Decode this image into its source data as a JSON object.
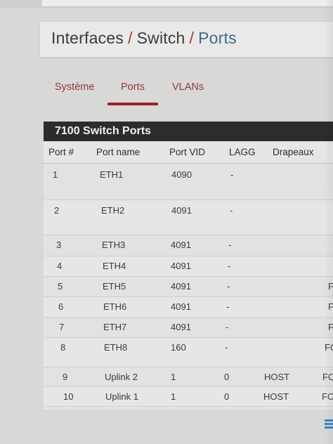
{
  "breadcrumb": {
    "items": [
      "Interfaces",
      "Switch"
    ],
    "current": "Ports",
    "separator": "/"
  },
  "tabs": [
    {
      "label": "Système",
      "active": false
    },
    {
      "label": "Ports",
      "active": true
    },
    {
      "label": "VLANs",
      "active": false
    }
  ],
  "panel": {
    "title": "7100 Switch Ports",
    "columns": [
      "Port #",
      "Port name",
      "Port VID",
      "LAGG",
      "Drapeaux"
    ],
    "rows": [
      {
        "port": "1",
        "name": "ETH1",
        "vid": "4090",
        "lagg": "-",
        "flags": "",
        "extra": ""
      },
      {
        "port": "2",
        "name": "ETH2",
        "vid": "4091",
        "lagg": "-",
        "flags": "",
        "extra": ""
      },
      {
        "port": "3",
        "name": "ETH3",
        "vid": "4091",
        "lagg": "-",
        "flags": "",
        "extra": ""
      },
      {
        "port": "4",
        "name": "ETH4",
        "vid": "4091",
        "lagg": "-",
        "flags": "",
        "extra": ""
      },
      {
        "port": "5",
        "name": "ETH5",
        "vid": "4091",
        "lagg": "-",
        "flags": "",
        "extra": "F"
      },
      {
        "port": "6",
        "name": "ETH6",
        "vid": "4091",
        "lagg": "-",
        "flags": "",
        "extra": "F"
      },
      {
        "port": "7",
        "name": "ETH7",
        "vid": "4091",
        "lagg": "-",
        "flags": "",
        "extra": "F"
      },
      {
        "port": "8",
        "name": "ETH8",
        "vid": "160",
        "lagg": "-",
        "flags": "",
        "extra": "FO"
      },
      {
        "port": "9",
        "name": "Uplink 2",
        "vid": "1",
        "lagg": "0",
        "flags": "HOST",
        "extra": "FO"
      },
      {
        "port": "10",
        "name": "Uplink 1",
        "vid": "1",
        "lagg": "0",
        "flags": "HOST",
        "extra": "FO"
      }
    ]
  },
  "colors": {
    "accent": "#a11f24",
    "heading_bg": "#2c2c2c",
    "breadcrumb_current": "#3d6b93"
  }
}
